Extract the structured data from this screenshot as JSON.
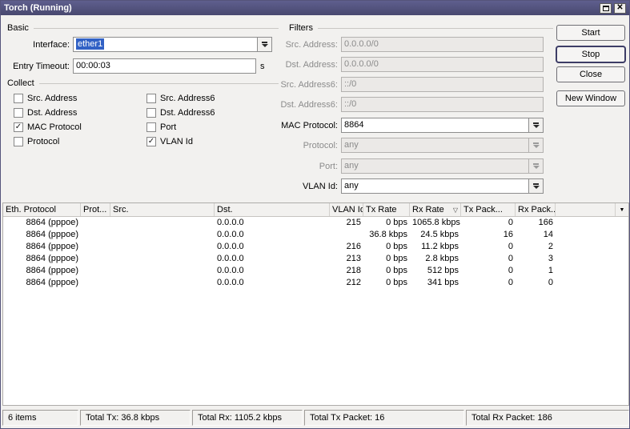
{
  "window": {
    "title": "Torch (Running)"
  },
  "colors": {
    "titlebar_top": "#5f5f8e",
    "titlebar_bottom": "#48486f",
    "selection": "#3161c5"
  },
  "basic": {
    "legend": "Basic",
    "interface_label": "Interface:",
    "interface_value": "ether1",
    "entry_timeout_label": "Entry Timeout:",
    "entry_timeout_value": "00:00:03",
    "entry_timeout_unit": "s"
  },
  "collect": {
    "legend": "Collect",
    "checkboxes": [
      {
        "label": "Src. Address",
        "checked": false
      },
      {
        "label": "Dst. Address",
        "checked": false
      },
      {
        "label": "MAC Protocol",
        "checked": true
      },
      {
        "label": "Protocol",
        "checked": false
      },
      {
        "label": "Src. Address6",
        "checked": false
      },
      {
        "label": "Dst. Address6",
        "checked": false
      },
      {
        "label": "Port",
        "checked": false
      },
      {
        "label": "VLAN Id",
        "checked": true
      }
    ]
  },
  "filters": {
    "legend": "Filters",
    "rows": [
      {
        "label": "Src. Address:",
        "value": "0.0.0.0/0",
        "enabled": false,
        "combo": false
      },
      {
        "label": "Dst. Address:",
        "value": "0.0.0.0/0",
        "enabled": false,
        "combo": false
      },
      {
        "label": "Src. Address6:",
        "value": "::/0",
        "enabled": false,
        "combo": false
      },
      {
        "label": "Dst. Address6:",
        "value": "::/0",
        "enabled": false,
        "combo": false
      },
      {
        "label": "MAC Protocol:",
        "value": "8864",
        "enabled": true,
        "combo": true
      },
      {
        "label": "Protocol:",
        "value": "any",
        "enabled": false,
        "combo": true
      },
      {
        "label": "Port:",
        "value": "any",
        "enabled": false,
        "combo": true
      },
      {
        "label": "VLAN Id:",
        "value": "any",
        "enabled": true,
        "combo": true
      }
    ]
  },
  "buttons": [
    {
      "label": "Start",
      "focused": false
    },
    {
      "label": "Stop",
      "focused": true
    },
    {
      "label": "Close",
      "focused": false
    },
    {
      "label": "New Window",
      "focused": false
    }
  ],
  "table": {
    "columns": [
      "Eth. Protocol",
      "Prot...",
      "Src.",
      "Dst.",
      "VLAN Id",
      "Tx Rate",
      "Rx Rate",
      "Tx Pack...",
      "Rx Pack..."
    ],
    "sorted_column": "Rx Rate",
    "sort_indicator": "▽",
    "rows": [
      [
        "8864 (pppoe)",
        "",
        "",
        "0.0.0.0",
        "215",
        "0 bps",
        "1065.8 kbps",
        "0",
        "166"
      ],
      [
        "8864 (pppoe)",
        "",
        "",
        "0.0.0.0",
        "",
        "36.8 kbps",
        "24.5 kbps",
        "16",
        "14"
      ],
      [
        "8864 (pppoe)",
        "",
        "",
        "0.0.0.0",
        "216",
        "0 bps",
        "11.2 kbps",
        "0",
        "2"
      ],
      [
        "8864 (pppoe)",
        "",
        "",
        "0.0.0.0",
        "213",
        "0 bps",
        "2.8 kbps",
        "0",
        "3"
      ],
      [
        "8864 (pppoe)",
        "",
        "",
        "0.0.0.0",
        "218",
        "0 bps",
        "512 bps",
        "0",
        "1"
      ],
      [
        "8864 (pppoe)",
        "",
        "",
        "0.0.0.0",
        "212",
        "0 bps",
        "341 bps",
        "0",
        "0"
      ]
    ]
  },
  "status_bar": {
    "segments": [
      "6 items",
      "Total Tx: 36.8 kbps",
      "Total Rx: 1105.2 kbps",
      "Total Tx Packet: 16",
      "Total Rx Packet: 186"
    ]
  }
}
